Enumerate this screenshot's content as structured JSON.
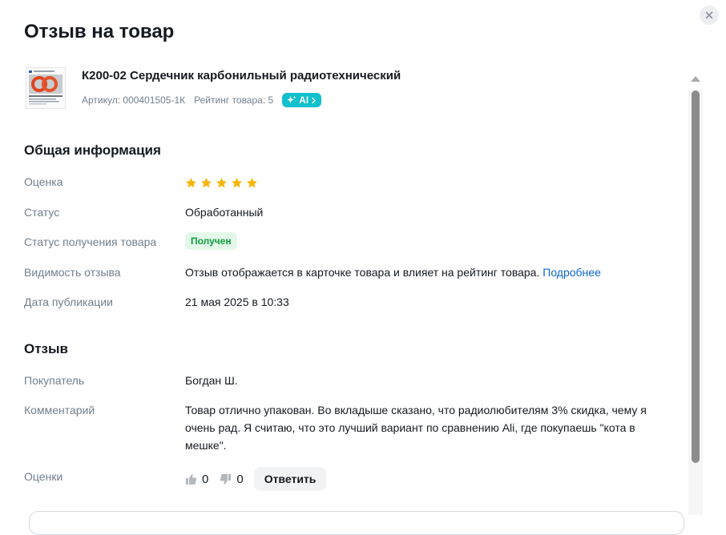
{
  "modal": {
    "title": "Отзыв на товар",
    "close_icon": "close-icon"
  },
  "product": {
    "name": "К200-02 Сердечник карбонильный радиотехнический",
    "article": "Артикул: 000401505-1К",
    "rating": "Рейтинг товара: 5",
    "ai_label": "AI",
    "ai_icon": "sparkle-icon",
    "ai_chevron_icon": "chevron-right-icon",
    "thumbnail_icon": "product-image"
  },
  "general": {
    "title": "Общая информация",
    "rows": {
      "rating_label": "Оценка",
      "rating_value": 5,
      "rating_max": 5,
      "status_label": "Статус",
      "status_value": "Обработанный",
      "receipt_label": "Статус получения товара",
      "receipt_value": "Получен",
      "visibility_label": "Видимость отзыва",
      "visibility_value": "Отзыв отображается в карточке товара и влияет на рейтинг товара.",
      "visibility_link": "Подробнее",
      "date_label": "Дата публикации",
      "date_value": "21 мая 2025 в 10:33"
    }
  },
  "review": {
    "title": "Отзыв",
    "buyer_label": "Покупатель",
    "buyer_value": "Богдан Ш.",
    "comment_label": "Комментарий",
    "comment_value": "Товар отлично упакован. Во вкладыше сказано, что радиолюбителям 3% скидка, чему я очень рад. Я считаю, что это лучший вариант по сравнению Ali, где покупаешь \"кота в мешке\".",
    "votes_label": "Оценки",
    "likes": "0",
    "dislikes": "0",
    "reply_label": "Ответить"
  },
  "colors": {
    "star": "#f7b500",
    "ai_badge": "#10c0cc",
    "pill_bg": "#e4f8ea",
    "pill_text": "#0d9d3c",
    "link": "#0a66d6",
    "label": "#707f8d"
  }
}
